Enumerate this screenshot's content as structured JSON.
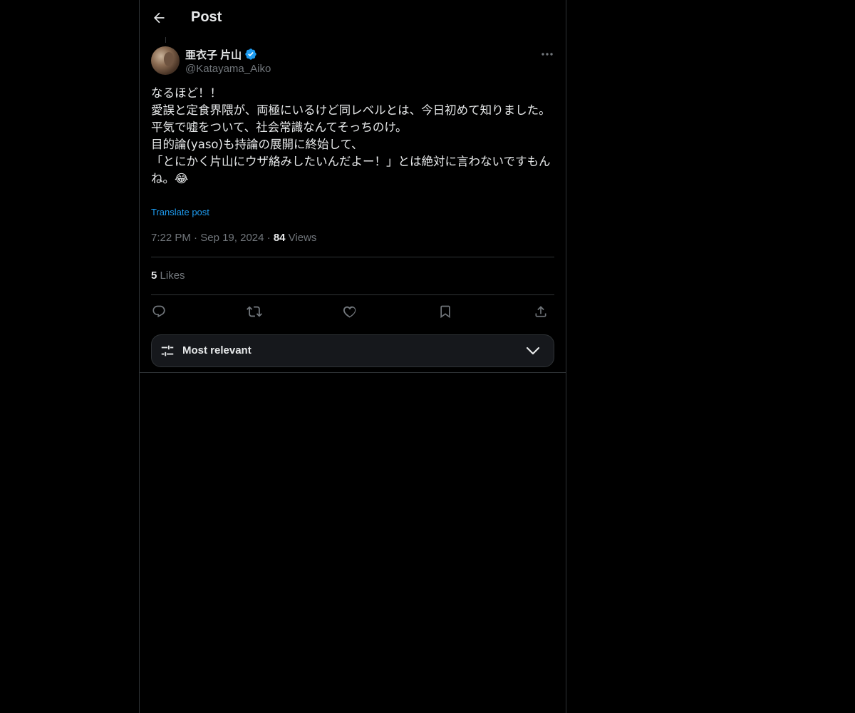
{
  "header": {
    "title": "Post"
  },
  "author": {
    "display_name": "亜衣子 片山",
    "handle": "@Katayama_Aiko",
    "verified": true
  },
  "post": {
    "text": "なるほど！！\n愛誤と定食界隈が、両極にいるけど同レベルとは、今日初めて知りました。\n平気で嘘をついて、社会常識なんてそっちのけ。\n目的論(yaso)も持論の展開に終始して、\n「とにかく片山にウザ絡みしたいんだよー！」とは絶対に言わないですもんね。😂",
    "translate_label": "Translate post",
    "time": "7:22 PM",
    "date": "Sep 19, 2024",
    "separator": "·",
    "views_count": "84",
    "views_label": "Views",
    "likes_count": "5",
    "likes_label": "Likes"
  },
  "sort": {
    "label": "Most relevant"
  },
  "colors": {
    "background": "#000000",
    "text": "#e7e9ea",
    "muted": "#71767b",
    "link": "#1d9bf0",
    "border": "#2f3336",
    "verified": "#1d9bf0"
  },
  "icons": {
    "back": "arrow-left-icon",
    "verified": "verified-badge-icon",
    "more": "more-horizontal-icon",
    "reply": "reply-icon",
    "repost": "repost-icon",
    "like": "heart-icon",
    "bookmark": "bookmark-icon",
    "share": "share-icon",
    "sort": "sliders-icon",
    "chevron": "chevron-down-icon"
  }
}
